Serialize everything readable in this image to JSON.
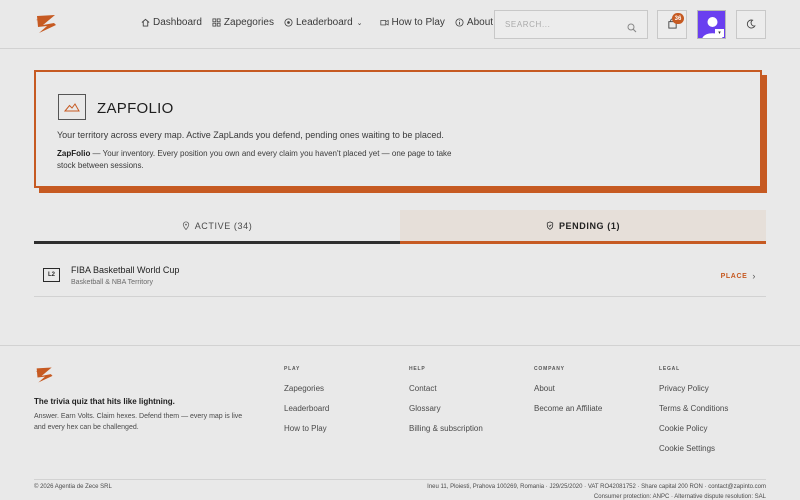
{
  "colors": {
    "accent": "#c65a22",
    "background": "#e9e9e9",
    "avatar": "#6a3ff0",
    "tab_pending_bg": "#e6dfd9"
  },
  "header": {
    "nav": [
      {
        "label": "Dashboard",
        "icon": "home-icon"
      },
      {
        "label": "Zapegories",
        "icon": "grid-icon"
      },
      {
        "label": "Leaderboard",
        "icon": "target-icon",
        "has_dropdown": true
      },
      {
        "label": "How to Play",
        "icon": "gamepad-icon"
      },
      {
        "label": "About",
        "icon": "info-icon"
      }
    ],
    "search_placeholder": "SEARCH...",
    "notifications_count": "36"
  },
  "card": {
    "title": "ZAPFOLIO",
    "description": "Your territory across every map. Active ZapLands you defend, pending ones waiting to be placed.",
    "note_bold": "ZapFolio",
    "note_text": " — Your inventory. Every position you own and every claim you haven't placed yet — one page to take stock between sessions."
  },
  "tabs": [
    {
      "label": "ACTIVE (34)",
      "icon": "pin-icon",
      "state": "inactive"
    },
    {
      "label": "PENDING (1)",
      "icon": "shield-icon",
      "state": "selected"
    }
  ],
  "items": [
    {
      "level": "L2",
      "title": "FIBA Basketball World Cup",
      "subtitle": "Basketball & NBA Territory",
      "action": "PLACE"
    }
  ],
  "footer": {
    "tagline": "The trivia quiz that hits like lightning.",
    "description": "Answer. Earn Volts. Claim hexes. Defend them — every map is live and every hex can be challenged.",
    "columns": [
      {
        "heading": "PLAY",
        "links": [
          "Zapegories",
          "Leaderboard",
          "How to Play"
        ]
      },
      {
        "heading": "HELP",
        "links": [
          "Contact",
          "Glossary",
          "Billing & subscription"
        ]
      },
      {
        "heading": "COMPANY",
        "links": [
          "About",
          "Become an Affiliate"
        ]
      },
      {
        "heading": "LEGAL",
        "links": [
          "Privacy Policy",
          "Terms & Conditions",
          "Cookie Policy",
          "Cookie Settings"
        ]
      }
    ],
    "copyright": "© 2026 Agentia de Zece SRL",
    "legal_line": "Ineu 11, Ploiesti, Prahova 100269, Romania · J29/25/2020 · VAT RO42081752 · Share capital 200 RON · contact@zapinto.com",
    "legal_line2": "Consumer protection: ANPC · Alternative dispute resolution: SAL"
  }
}
